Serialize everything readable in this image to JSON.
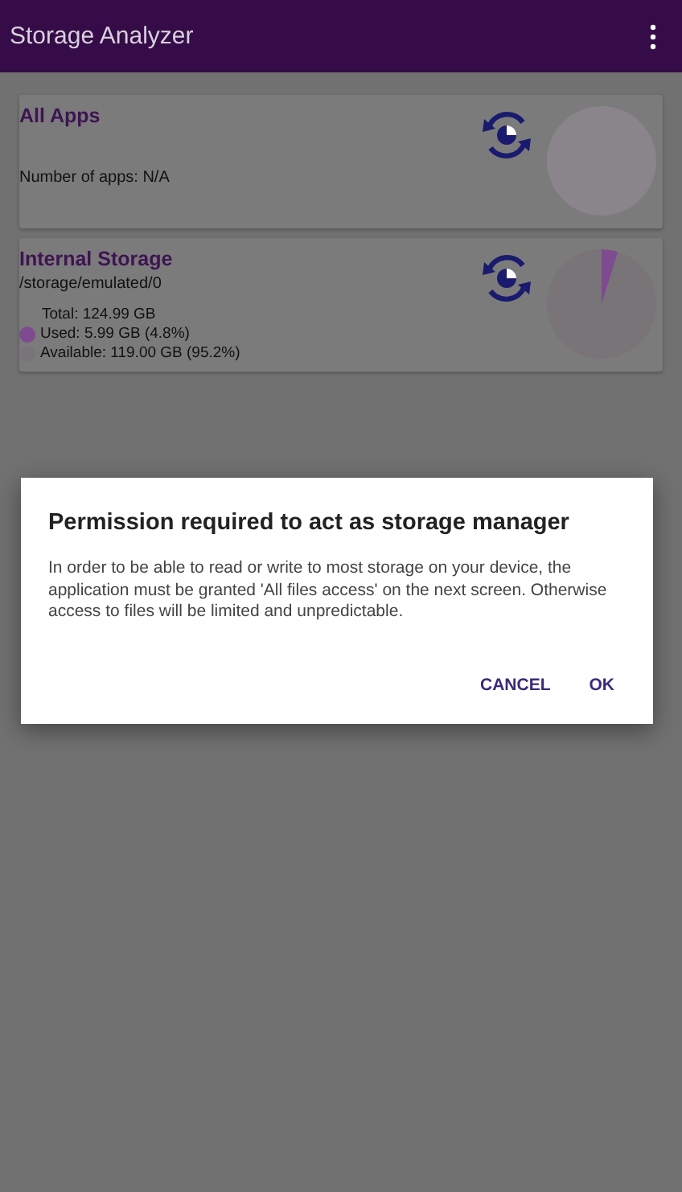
{
  "app_bar": {
    "title": "Storage Analyzer"
  },
  "cards": [
    {
      "kind": "apps",
      "title": "All Apps",
      "info": "Number of apps: N/A"
    },
    {
      "kind": "storage",
      "title": "Internal Storage",
      "path": "/storage/emulated/0",
      "total": "Total: 124.99 GB",
      "legend": [
        {
          "label": "Used: 5.99 GB (4.8%)",
          "color": "#7e4a90"
        },
        {
          "label": "Available: 119.00 GB (95.2%)",
          "color": "#787478"
        }
      ],
      "chart_data": {
        "type": "pie",
        "values": [
          4.8,
          95.2
        ]
      }
    }
  ],
  "dialog": {
    "title": "Permission required to act as storage manager",
    "message": "In order to be able to read or write to most storage on your device, the application must be granted 'All files access' on the next screen. Otherwise access to files will be limited and unpredictable.",
    "buttons": [
      "CANCEL",
      "OK"
    ]
  }
}
